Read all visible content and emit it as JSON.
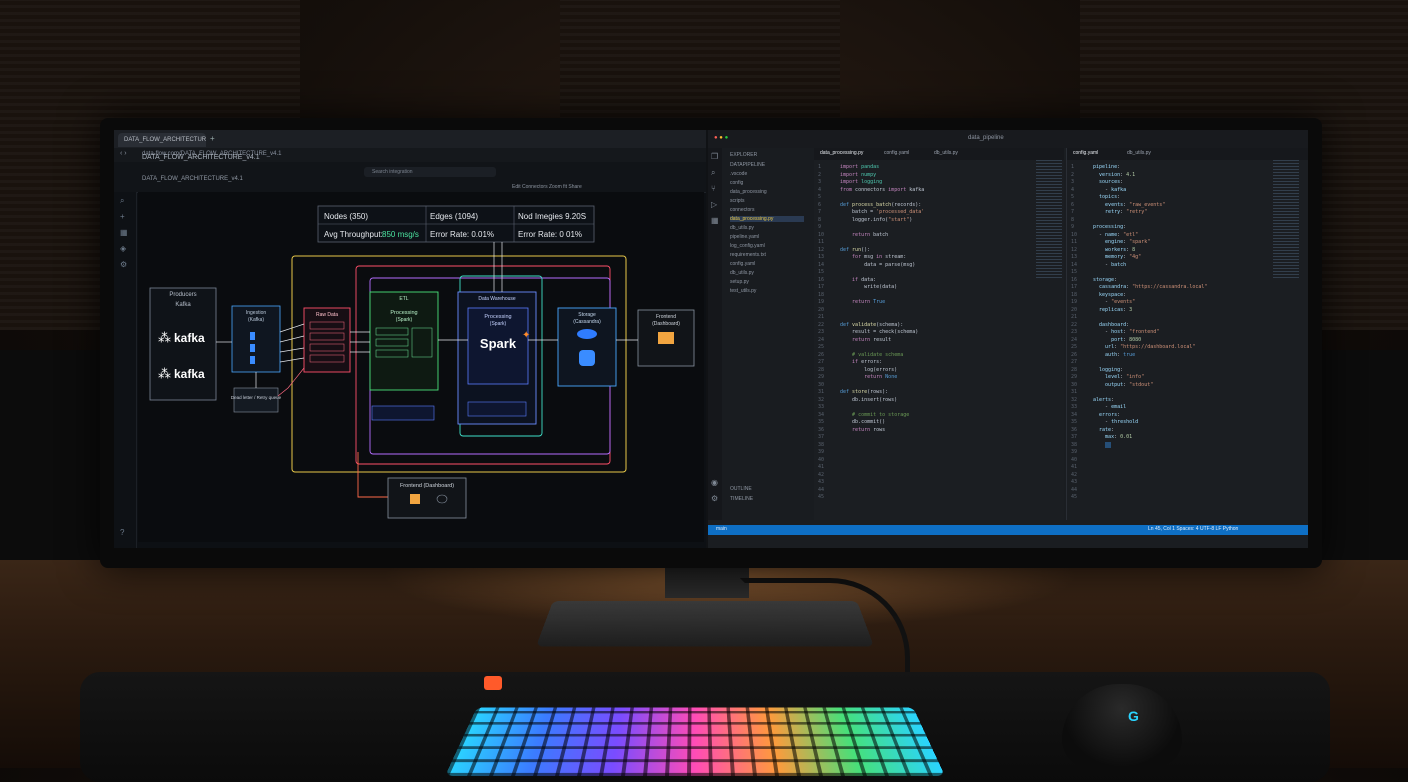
{
  "browser": {
    "tab_title": "DATA_FLOW_ARCHITECTURE_v4.1",
    "url": "data-flow.com/DATA_FLOW_ARCHITECTURE_v4.1",
    "doc_title": "DATA_FLOW_ARCHITECTURE_v4.1",
    "search_placeholder": "Search integration",
    "toolbar": "Edit    Connectors    Zoom fit    Share"
  },
  "metrics": {
    "nodes": "Nodes (350)",
    "edges": "Edges (1094)",
    "nodes_throughput": "Nod Imegies 9.20S",
    "avg_throughput_label": "Avg Throughput:",
    "avg_throughput_value": "850 msg/s",
    "error_rate_1": "Error Rate: 0.01%",
    "error_rate_2": "Error Rate: 0 01%"
  },
  "diagram": {
    "producers_title": "Producers",
    "kafka_title": "Kafka",
    "kafka_label": "kafka",
    "ingestion_title": "Ingestion",
    "ingestion_sub": "(Kafka)",
    "dead_letter": "Dead letter / Retry queue",
    "raw_title": "Raw Data",
    "etl_title": "ETL",
    "processing_title": "Processing",
    "processing_sub": "(Spark)",
    "db_title": "Data Warehouse",
    "spark_label": "Spark",
    "storage_title": "Storage",
    "storage_sub": "(Cassandra)",
    "frontend_title": "Frontend",
    "frontend_sub": "(Dashboard)",
    "frontend_bottom": "Frontend (Dashboard)"
  },
  "vscode": {
    "title_search": "data_pipeline",
    "tab1": "data_processing.py",
    "tab2": "config.yaml",
    "tab3": "db_utils.py",
    "tab4": "config.yaml",
    "tab5": "db_utils.py",
    "explorer": [
      "EXPLORER",
      "DATAPIPELINE",
      "  .vscode",
      "  config",
      "  data_processing",
      "  scripts",
      "  connectors",
      "  data_processing.py",
      "  db_utils.py",
      "  pipeline.yaml",
      "  log_config.yaml",
      "  requirements.txt",
      "  config.yaml",
      "  db_utils.py",
      "  setup.py",
      "  test_utils.py"
    ],
    "outline": "OUTLINE",
    "timeline": "TIMELINE",
    "status_left": "main",
    "status_right": "Ln 45, Col 1    Spaces: 4    UTF-8    LF    Python"
  }
}
